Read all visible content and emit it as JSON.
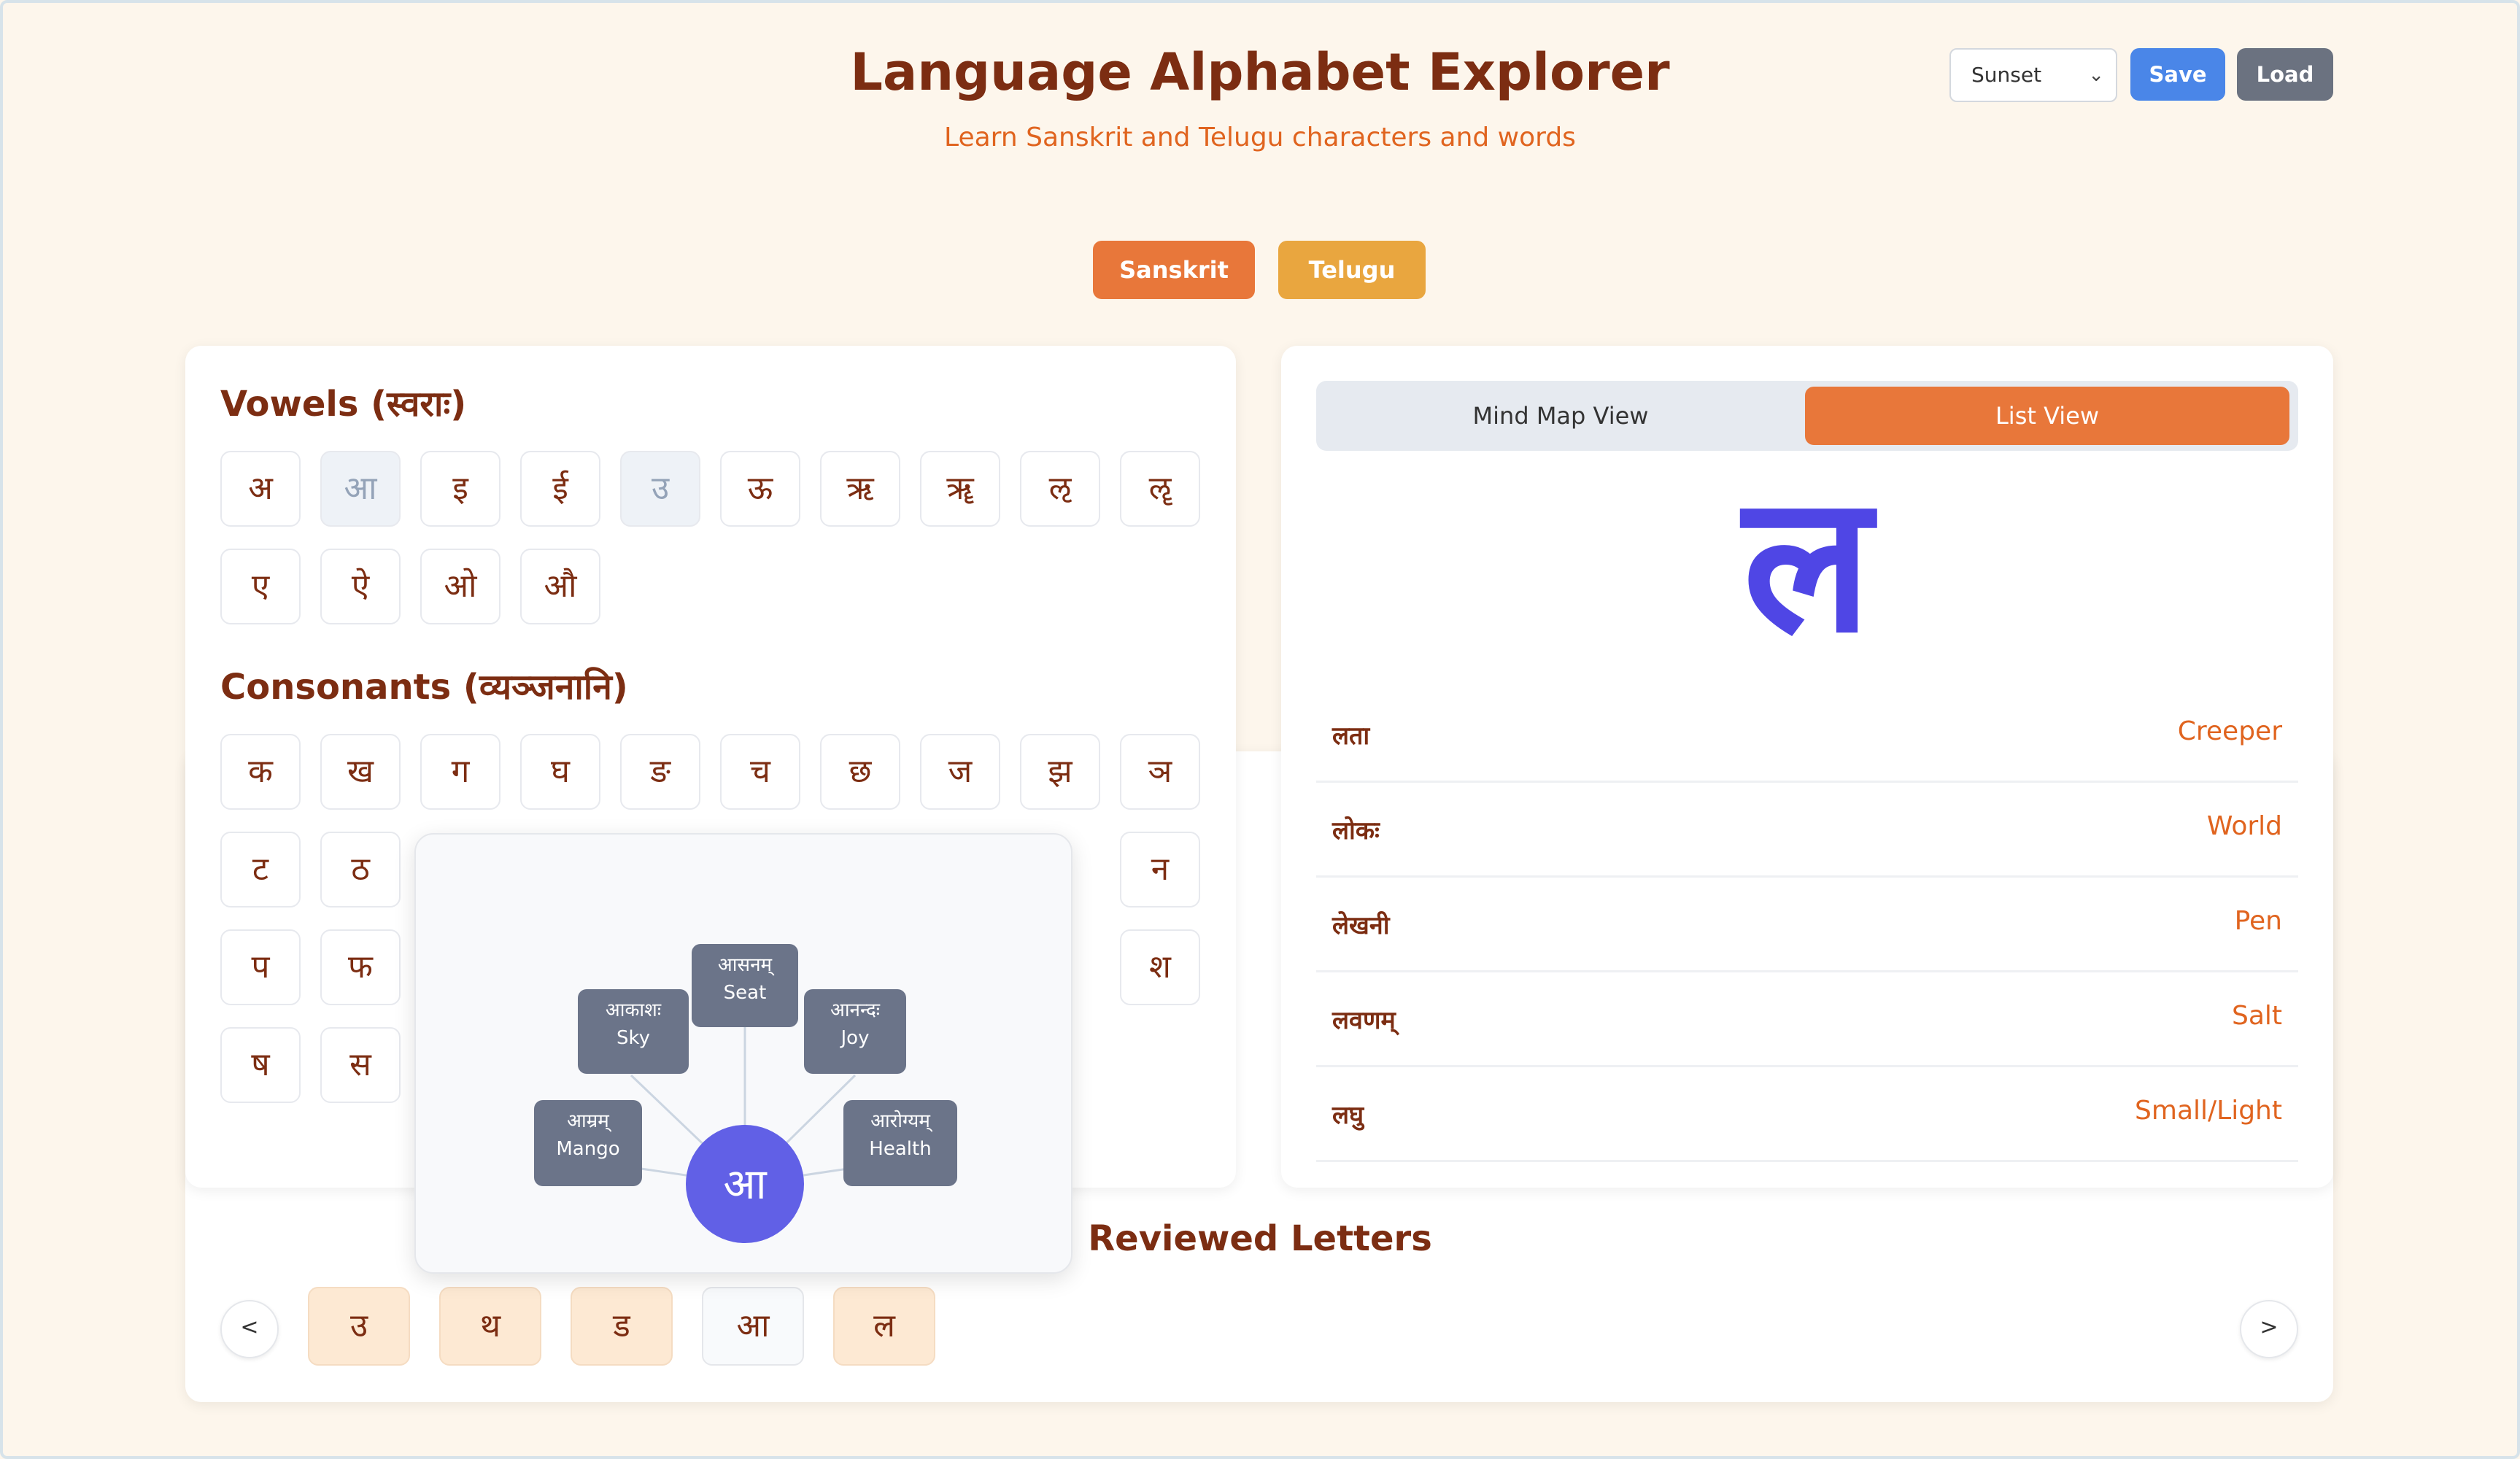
{
  "header": {
    "title": "Language Alphabet Explorer",
    "subtitle": "Learn Sanskrit and Telugu characters and words",
    "theme_value": "Sunset",
    "save_label": "Save",
    "load_label": "Load"
  },
  "languages": [
    "Sanskrit",
    "Telugu"
  ],
  "vowels": {
    "title": "Vowels (स्वराः)",
    "letters": [
      "अ",
      "आ",
      "इ",
      "ई",
      "उ",
      "ऊ",
      "ऋ",
      "ॠ",
      "ऌ",
      "ॡ",
      "ए",
      "ऐ",
      "ओ",
      "औ"
    ]
  },
  "consonants": {
    "title": "Consonants (व्यञ्जनानि)",
    "row1": [
      "क",
      "ख",
      "ग",
      "घ",
      "ङ",
      "च",
      "छ",
      "ज",
      "झ",
      "ञ"
    ],
    "row2": [
      "ट",
      "ठ",
      "न"
    ],
    "row3": [
      "प",
      "फ",
      "श"
    ],
    "row4": [
      "ष",
      "स"
    ]
  },
  "mindmap": {
    "center": "आ",
    "nodes": [
      {
        "sa": "आसनम्",
        "en": "Seat"
      },
      {
        "sa": "आकाशः",
        "en": "Sky"
      },
      {
        "sa": "आनन्दः",
        "en": "Joy"
      },
      {
        "sa": "आम्रम्",
        "en": "Mango"
      },
      {
        "sa": "आरोग्यम्",
        "en": "Health"
      }
    ]
  },
  "detail": {
    "tab_mind": "Mind Map View",
    "tab_list": "List View",
    "letter": "ल",
    "words": [
      {
        "sa": "लता",
        "en": "Creeper"
      },
      {
        "sa": "लोकः",
        "en": "World"
      },
      {
        "sa": "लेखनी",
        "en": "Pen"
      },
      {
        "sa": "लवणम्",
        "en": "Salt"
      },
      {
        "sa": "लघु",
        "en": "Small/Light"
      }
    ]
  },
  "reviewed": {
    "title": "Reviewed Letters",
    "prev": "<",
    "next": ">",
    "letters": [
      "उ",
      "थ",
      "ड",
      "आ",
      "ल"
    ]
  },
  "colors": {
    "accent": "#e8773a",
    "telugu": "#e9a63f",
    "letter": "#4f46e5",
    "mindmap_center": "#6160e6",
    "node": "#6b7489"
  }
}
